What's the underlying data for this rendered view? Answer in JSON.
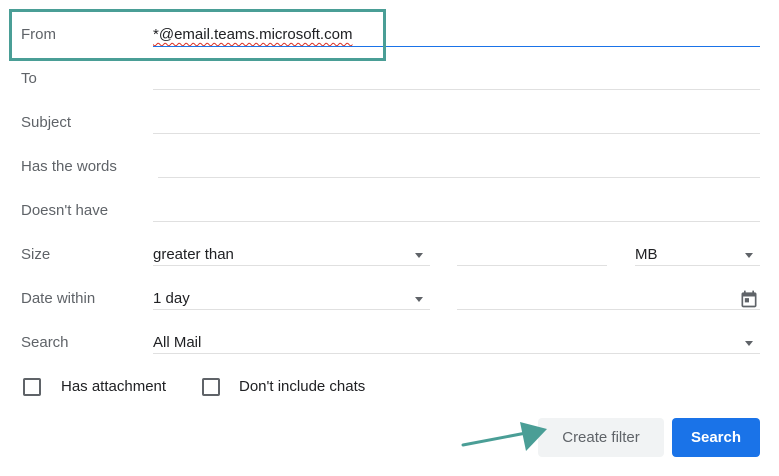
{
  "fields": {
    "from": {
      "label": "From",
      "value": "*@email.teams.microsoft.com"
    },
    "to": {
      "label": "To",
      "value": ""
    },
    "subject": {
      "label": "Subject",
      "value": ""
    },
    "has_words": {
      "label": "Has the words",
      "value": ""
    },
    "doesnt_have": {
      "label": "Doesn't have",
      "value": ""
    },
    "size": {
      "label": "Size",
      "comparator": "greater than",
      "amount": "",
      "unit": "MB"
    },
    "date_within": {
      "label": "Date within",
      "range": "1 day",
      "date": ""
    },
    "search": {
      "label": "Search",
      "scope": "All Mail"
    }
  },
  "checkboxes": {
    "has_attachment": {
      "label": "Has attachment",
      "checked": false
    },
    "dont_include_chats": {
      "label": "Don't include chats",
      "checked": false
    }
  },
  "buttons": {
    "create_filter": "Create filter",
    "search": "Search"
  },
  "icons": {
    "calendar": "calendar-icon",
    "dropdown": "arrow-drop-down-icon",
    "annotation": "arrow-annotation"
  },
  "colors": {
    "accent": "#1a73e8",
    "highlight": "#4a9e96"
  }
}
